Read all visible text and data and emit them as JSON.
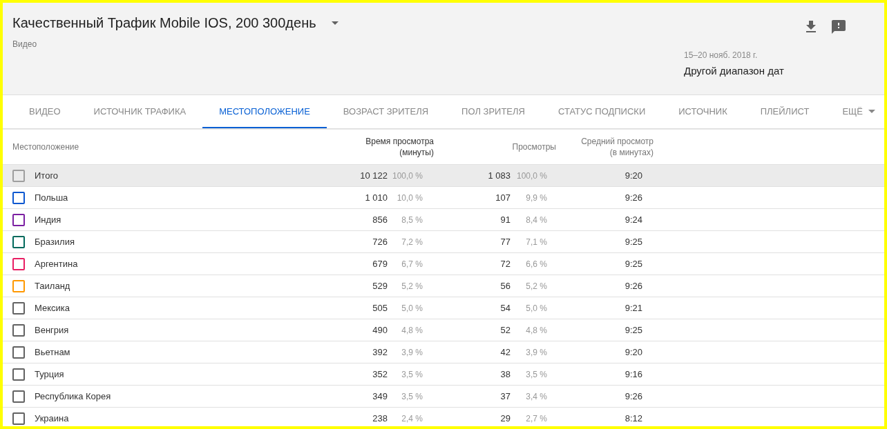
{
  "header": {
    "title": "Качественный Трафик Mobile IOS, 200 300день",
    "subtitle": "Видео",
    "date_range": "15–20 нояб. 2018 г.",
    "date_picker": "Другой диапазон дат"
  },
  "tabs": [
    {
      "label": "ВИДЕО",
      "selected": false
    },
    {
      "label": "ИСТОЧНИК ТРАФИКА",
      "selected": false
    },
    {
      "label": "МЕСТОПОЛОЖЕНИЕ",
      "selected": true
    },
    {
      "label": "ВОЗРАСТ ЗРИТЕЛЯ",
      "selected": false
    },
    {
      "label": "ПОЛ ЗРИТЕЛЯ",
      "selected": false
    },
    {
      "label": "СТАТУС ПОДПИСКИ",
      "selected": false
    },
    {
      "label": "ИСТОЧНИК",
      "selected": false
    },
    {
      "label": "ПЛЕЙЛИСТ",
      "selected": false
    },
    {
      "label": "ЕЩЁ",
      "selected": false,
      "kind": "menu"
    }
  ],
  "table": {
    "columns": [
      "Местоположение",
      "Время просмотра (минуты)",
      "Просмотры",
      "Средний просмотр (в минутах)"
    ],
    "rows": [
      {
        "kind": "total",
        "name": "Итого",
        "color": "#9e9e9e",
        "watch_time": "10 122",
        "watch_share": "100,0 %",
        "views": "1 083",
        "views_share": "100,0 %",
        "avg": "9:20"
      },
      {
        "kind": "country",
        "name": "Польша",
        "color": "#0b57d0",
        "watch_time": "1 010",
        "watch_share": "10,0 %",
        "views": "107",
        "views_share": "9,9 %",
        "avg": "9:26"
      },
      {
        "kind": "country",
        "name": "Индия",
        "color": "#7b1fa2",
        "watch_time": "856",
        "watch_share": "8,5 %",
        "views": "91",
        "views_share": "8,4 %",
        "avg": "9:24"
      },
      {
        "kind": "country",
        "name": "Бразилия",
        "color": "#00695c",
        "watch_time": "726",
        "watch_share": "7,2 %",
        "views": "77",
        "views_share": "7,1 %",
        "avg": "9:25"
      },
      {
        "kind": "country",
        "name": "Аргентина",
        "color": "#e91e63",
        "watch_time": "679",
        "watch_share": "6,7 %",
        "views": "72",
        "views_share": "6,6 %",
        "avg": "9:25"
      },
      {
        "kind": "country",
        "name": "Таиланд",
        "color": "#ff9800",
        "watch_time": "529",
        "watch_share": "5,2 %",
        "views": "56",
        "views_share": "5,2 %",
        "avg": "9:26"
      },
      {
        "kind": "country",
        "name": "Мексика",
        "color": "#616161",
        "watch_time": "505",
        "watch_share": "5,0 %",
        "views": "54",
        "views_share": "5,0 %",
        "avg": "9:21"
      },
      {
        "kind": "country",
        "name": "Венгрия",
        "color": "#616161",
        "watch_time": "490",
        "watch_share": "4,8 %",
        "views": "52",
        "views_share": "4,8 %",
        "avg": "9:25"
      },
      {
        "kind": "country",
        "name": "Вьетнам",
        "color": "#616161",
        "watch_time": "392",
        "watch_share": "3,9 %",
        "views": "42",
        "views_share": "3,9 %",
        "avg": "9:20"
      },
      {
        "kind": "country",
        "name": "Турция",
        "color": "#616161",
        "watch_time": "352",
        "watch_share": "3,5 %",
        "views": "38",
        "views_share": "3,5 %",
        "avg": "9:16"
      },
      {
        "kind": "country",
        "name": "Республика Корея",
        "color": "#616161",
        "watch_time": "349",
        "watch_share": "3,5 %",
        "views": "37",
        "views_share": "3,4 %",
        "avg": "9:26"
      },
      {
        "kind": "country",
        "name": "Украина",
        "color": "#616161",
        "watch_time": "238",
        "watch_share": "2,4 %",
        "views": "29",
        "views_share": "2,7 %",
        "avg": "8:12"
      }
    ]
  }
}
